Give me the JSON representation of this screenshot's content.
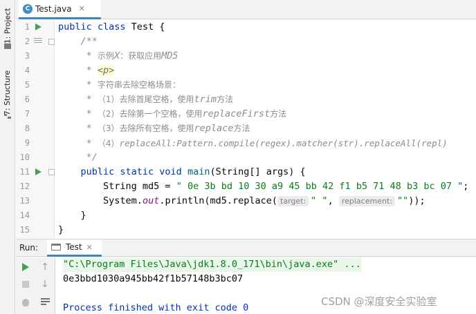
{
  "side_tabs": {
    "project": "1: Project",
    "structure": "7: Structure"
  },
  "editor": {
    "active_tab": "Test.java",
    "tab_icon_letter": "C",
    "line_numbers": [
      "1",
      "2",
      "3",
      "4",
      "5",
      "6",
      "7",
      "8",
      "9",
      "10",
      "11",
      "12",
      "13",
      "14",
      "15"
    ],
    "lines": {
      "l1": {
        "kw": "public class ",
        "rest": "Test {"
      },
      "l2": {
        "text": "/**"
      },
      "l3": {
        "star": "* ",
        "cjk1": "示例",
        "code": "X",
        "cjk2": "：获取应用",
        "code2": "MD5"
      },
      "l4": {
        "star": "* ",
        "tag": "<p>"
      },
      "l5": {
        "star": "* ",
        "cjk": "字符串去除空格场景："
      },
      "l6": {
        "star": "* ",
        "cjk1": "（1）去除首尾空格，使用",
        "code": "trim",
        "cjk2": "方法"
      },
      "l7": {
        "star": "* ",
        "cjk1": "（2）去除第一个空格，使用",
        "code": "replaceFirst",
        "cjk2": "方法"
      },
      "l8": {
        "star": "* ",
        "cjk1": "（3）去除所有空格，使用",
        "code": "replace",
        "cjk2": "方法"
      },
      "l9": {
        "star": "* ",
        "cjk1": "（4）",
        "code": "replaceAll:Pattern.compile(regex).matcher(str).replaceAll(repl)"
      },
      "l10": {
        "text": "*/"
      },
      "l11": {
        "kw": "public static void ",
        "fn": "main",
        "rest": "(String[] args) {"
      },
      "l12": {
        "pre": "String md5 = ",
        "str": "\" 0e 3b bd 10 30 a9 45 bb 42 f1 b5 71 48 b3 bc 07 \"",
        "post": ";"
      },
      "l13": {
        "pre": "System.",
        "field": "out",
        "mid": ".println(md5.replace(",
        "hint1": "target:",
        "str1": "\" \"",
        "comma": ", ",
        "hint2": "replacement:",
        "str2": "\"\"",
        "post": "));"
      },
      "l14": {
        "text": "}"
      },
      "l15": {
        "text": "}"
      }
    }
  },
  "run_panel": {
    "label": "Run:",
    "tab": "Test",
    "console": {
      "command": "\"C:\\Program Files\\Java\\jdk1.8.0_171\\bin\\java.exe\" ...",
      "output": "0e3bbd1030a945bb42f1b57148b3bc07",
      "exit": "Process finished with exit code 0"
    }
  },
  "watermark": "CSDN @深度安全实验室",
  "colors": {
    "keyword": "#0033b3",
    "comment": "#8c8c8c",
    "string": "#067d17",
    "field": "#871094",
    "method": "#00627a",
    "run_green": "#499c54",
    "tab_accent": "#4083c9"
  }
}
